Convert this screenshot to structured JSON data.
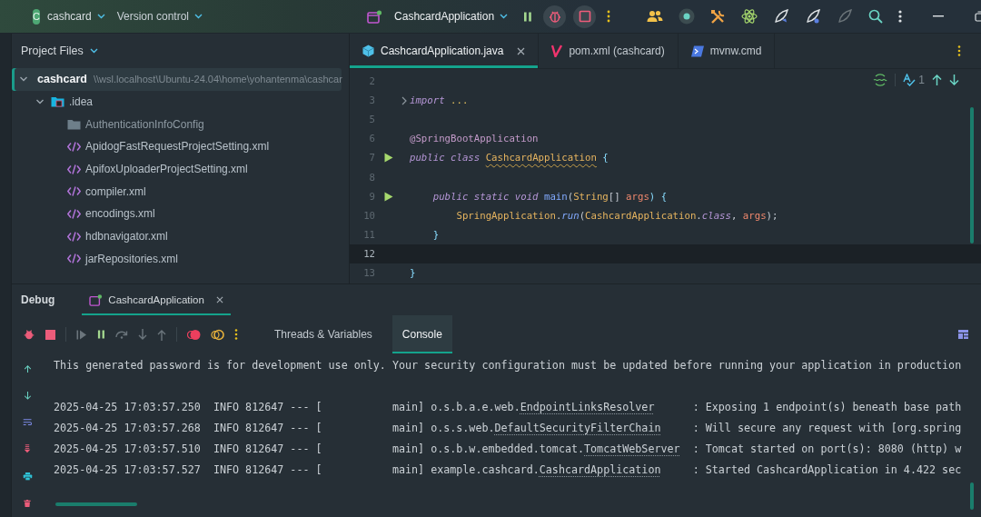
{
  "title_bar": {
    "project_badge": "C",
    "project": "cashcard",
    "vcs": "Version control",
    "run_config": "CashcardApplication"
  },
  "project_panel": {
    "title": "Project Files",
    "tree": [
      {
        "label": "cashcard",
        "path": "\\\\wsl.localhost\\Ubuntu-24.04\\home\\yohantenma\\cashcar",
        "kind": "module",
        "expanded": true,
        "selected": true,
        "children": [
          {
            "label": ".idea",
            "kind": "config-folder",
            "expanded": true,
            "selected": false,
            "children": [
              {
                "label": "AuthenticationInfoConfig",
                "kind": "folder",
                "selected": false
              },
              {
                "label": "ApidogFastRequestProjectSetting.xml",
                "kind": "file",
                "selected": false
              },
              {
                "label": "ApifoxUploaderProjectSetting.xml",
                "kind": "file",
                "selected": false
              },
              {
                "label": "compiler.xml",
                "kind": "file",
                "selected": false
              },
              {
                "label": "encodings.xml",
                "kind": "file",
                "selected": false
              },
              {
                "label": "hdbnavigator.xml",
                "kind": "file",
                "selected": false
              },
              {
                "label": "jarRepositories.xml",
                "kind": "file",
                "selected": false
              }
            ]
          }
        ]
      }
    ]
  },
  "editor": {
    "tabs": [
      {
        "label": "CashcardApplication.java",
        "kind": "source",
        "selected": true
      },
      {
        "label": "pom.xml (cashcard)",
        "kind": "build",
        "selected": false
      },
      {
        "label": "mvnw.cmd",
        "kind": "script",
        "selected": false
      }
    ],
    "problem_count": "1",
    "lines": [
      {
        "n": "2",
        "run": false,
        "folded": false,
        "current": false
      },
      {
        "n": "3",
        "run": false,
        "folded": true,
        "current": false,
        "tokens": [
          {
            "t": "import ",
            "kind": "keyword"
          },
          {
            "t": "...",
            "kind": "folded"
          }
        ]
      },
      {
        "n": "5",
        "run": false,
        "folded": false,
        "current": false
      },
      {
        "n": "6",
        "run": false,
        "folded": false,
        "current": false,
        "tokens": [
          {
            "t": "@SpringBootApplication",
            "kind": "annotation"
          }
        ]
      },
      {
        "n": "7",
        "run": true,
        "folded": false,
        "current": false,
        "tokens": [
          {
            "t": "public class ",
            "kind": "keyword"
          },
          {
            "t": "CashcardApplication",
            "kind": "warning"
          },
          {
            "t": " {",
            "kind": "brace"
          }
        ]
      },
      {
        "n": "8",
        "run": false,
        "folded": false,
        "current": false
      },
      {
        "n": "9",
        "run": true,
        "folded": false,
        "current": false,
        "tokens": [
          {
            "t": "    public static void ",
            "kind": "keyword"
          },
          {
            "t": "main",
            "kind": "method"
          },
          {
            "t": "(",
            "kind": "plain"
          },
          {
            "t": "String",
            "kind": "type"
          },
          {
            "t": "[] ",
            "kind": "plain"
          },
          {
            "t": "args",
            "kind": "parameter"
          },
          {
            "t": ") {",
            "kind": "brace"
          }
        ]
      },
      {
        "n": "10",
        "run": false,
        "folded": false,
        "current": false,
        "tokens": [
          {
            "t": "        SpringApplication",
            "kind": "type"
          },
          {
            "t": ".",
            "kind": "plain"
          },
          {
            "t": "run",
            "kind": "static-method"
          },
          {
            "t": "(",
            "kind": "plain"
          },
          {
            "t": "CashcardApplication",
            "kind": "type"
          },
          {
            "t": ".",
            "kind": "plain"
          },
          {
            "t": "class",
            "kind": "keyword"
          },
          {
            "t": ", ",
            "kind": "plain"
          },
          {
            "t": "args",
            "kind": "parameter"
          },
          {
            "t": ");",
            "kind": "plain"
          }
        ]
      },
      {
        "n": "11",
        "run": false,
        "folded": false,
        "current": false,
        "tokens": [
          {
            "t": "    }",
            "kind": "brace"
          }
        ]
      },
      {
        "n": "12",
        "run": false,
        "folded": false,
        "current": true
      },
      {
        "n": "13",
        "run": false,
        "folded": false,
        "current": false,
        "tokens": [
          {
            "t": "}",
            "kind": "brace"
          }
        ]
      }
    ]
  },
  "debug": {
    "title": "Debug",
    "sessions": [
      {
        "label": "CashcardApplication",
        "selected": true
      }
    ],
    "tabs": [
      {
        "label": "Threads & Variables",
        "selected": false
      },
      {
        "label": "Console",
        "selected": true
      }
    ],
    "console": [
      {
        "kind": "text",
        "text": "This generated password is for development use only. Your security configuration must be updated before running your application in production"
      },
      {
        "kind": "log",
        "head": "2025-04-25 17:03:57.250  INFO 812647 --- [           main] o.s.b.a.e.web.",
        "logger": "EndpointLinksResolver",
        "message": "      : Exposing 1 endpoint(s) beneath base path"
      },
      {
        "kind": "log",
        "head": "2025-04-25 17:03:57.268  INFO 812647 --- [           main] o.s.s.web.",
        "logger": "DefaultSecurityFilterChain",
        "message": "     : Will secure any request with [org.spring"
      },
      {
        "kind": "log",
        "head": "2025-04-25 17:03:57.510  INFO 812647 --- [           main] o.s.b.w.embedded.tomcat.",
        "logger": "TomcatWebServer",
        "message": "  : Tomcat started on port(s): 8080 (http) w"
      },
      {
        "kind": "log",
        "head": "2025-04-25 17:03:57.527  INFO 812647 --- [           main] example.cashcard.",
        "logger": "CashcardApplication",
        "message": "     : Started CashcardApplication in 4.422 sec"
      }
    ]
  }
}
